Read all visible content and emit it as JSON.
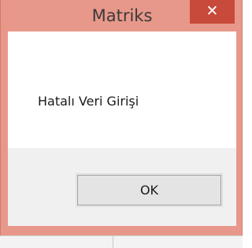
{
  "window": {
    "title": "Matriks",
    "close_glyph": "✕"
  },
  "dialog": {
    "message": "Hatalı Veri Girişi",
    "ok_label": "OK"
  },
  "colors": {
    "frame": "#e8988a",
    "close_button": "#c84a3a",
    "button_area": "#f0f0f0"
  }
}
